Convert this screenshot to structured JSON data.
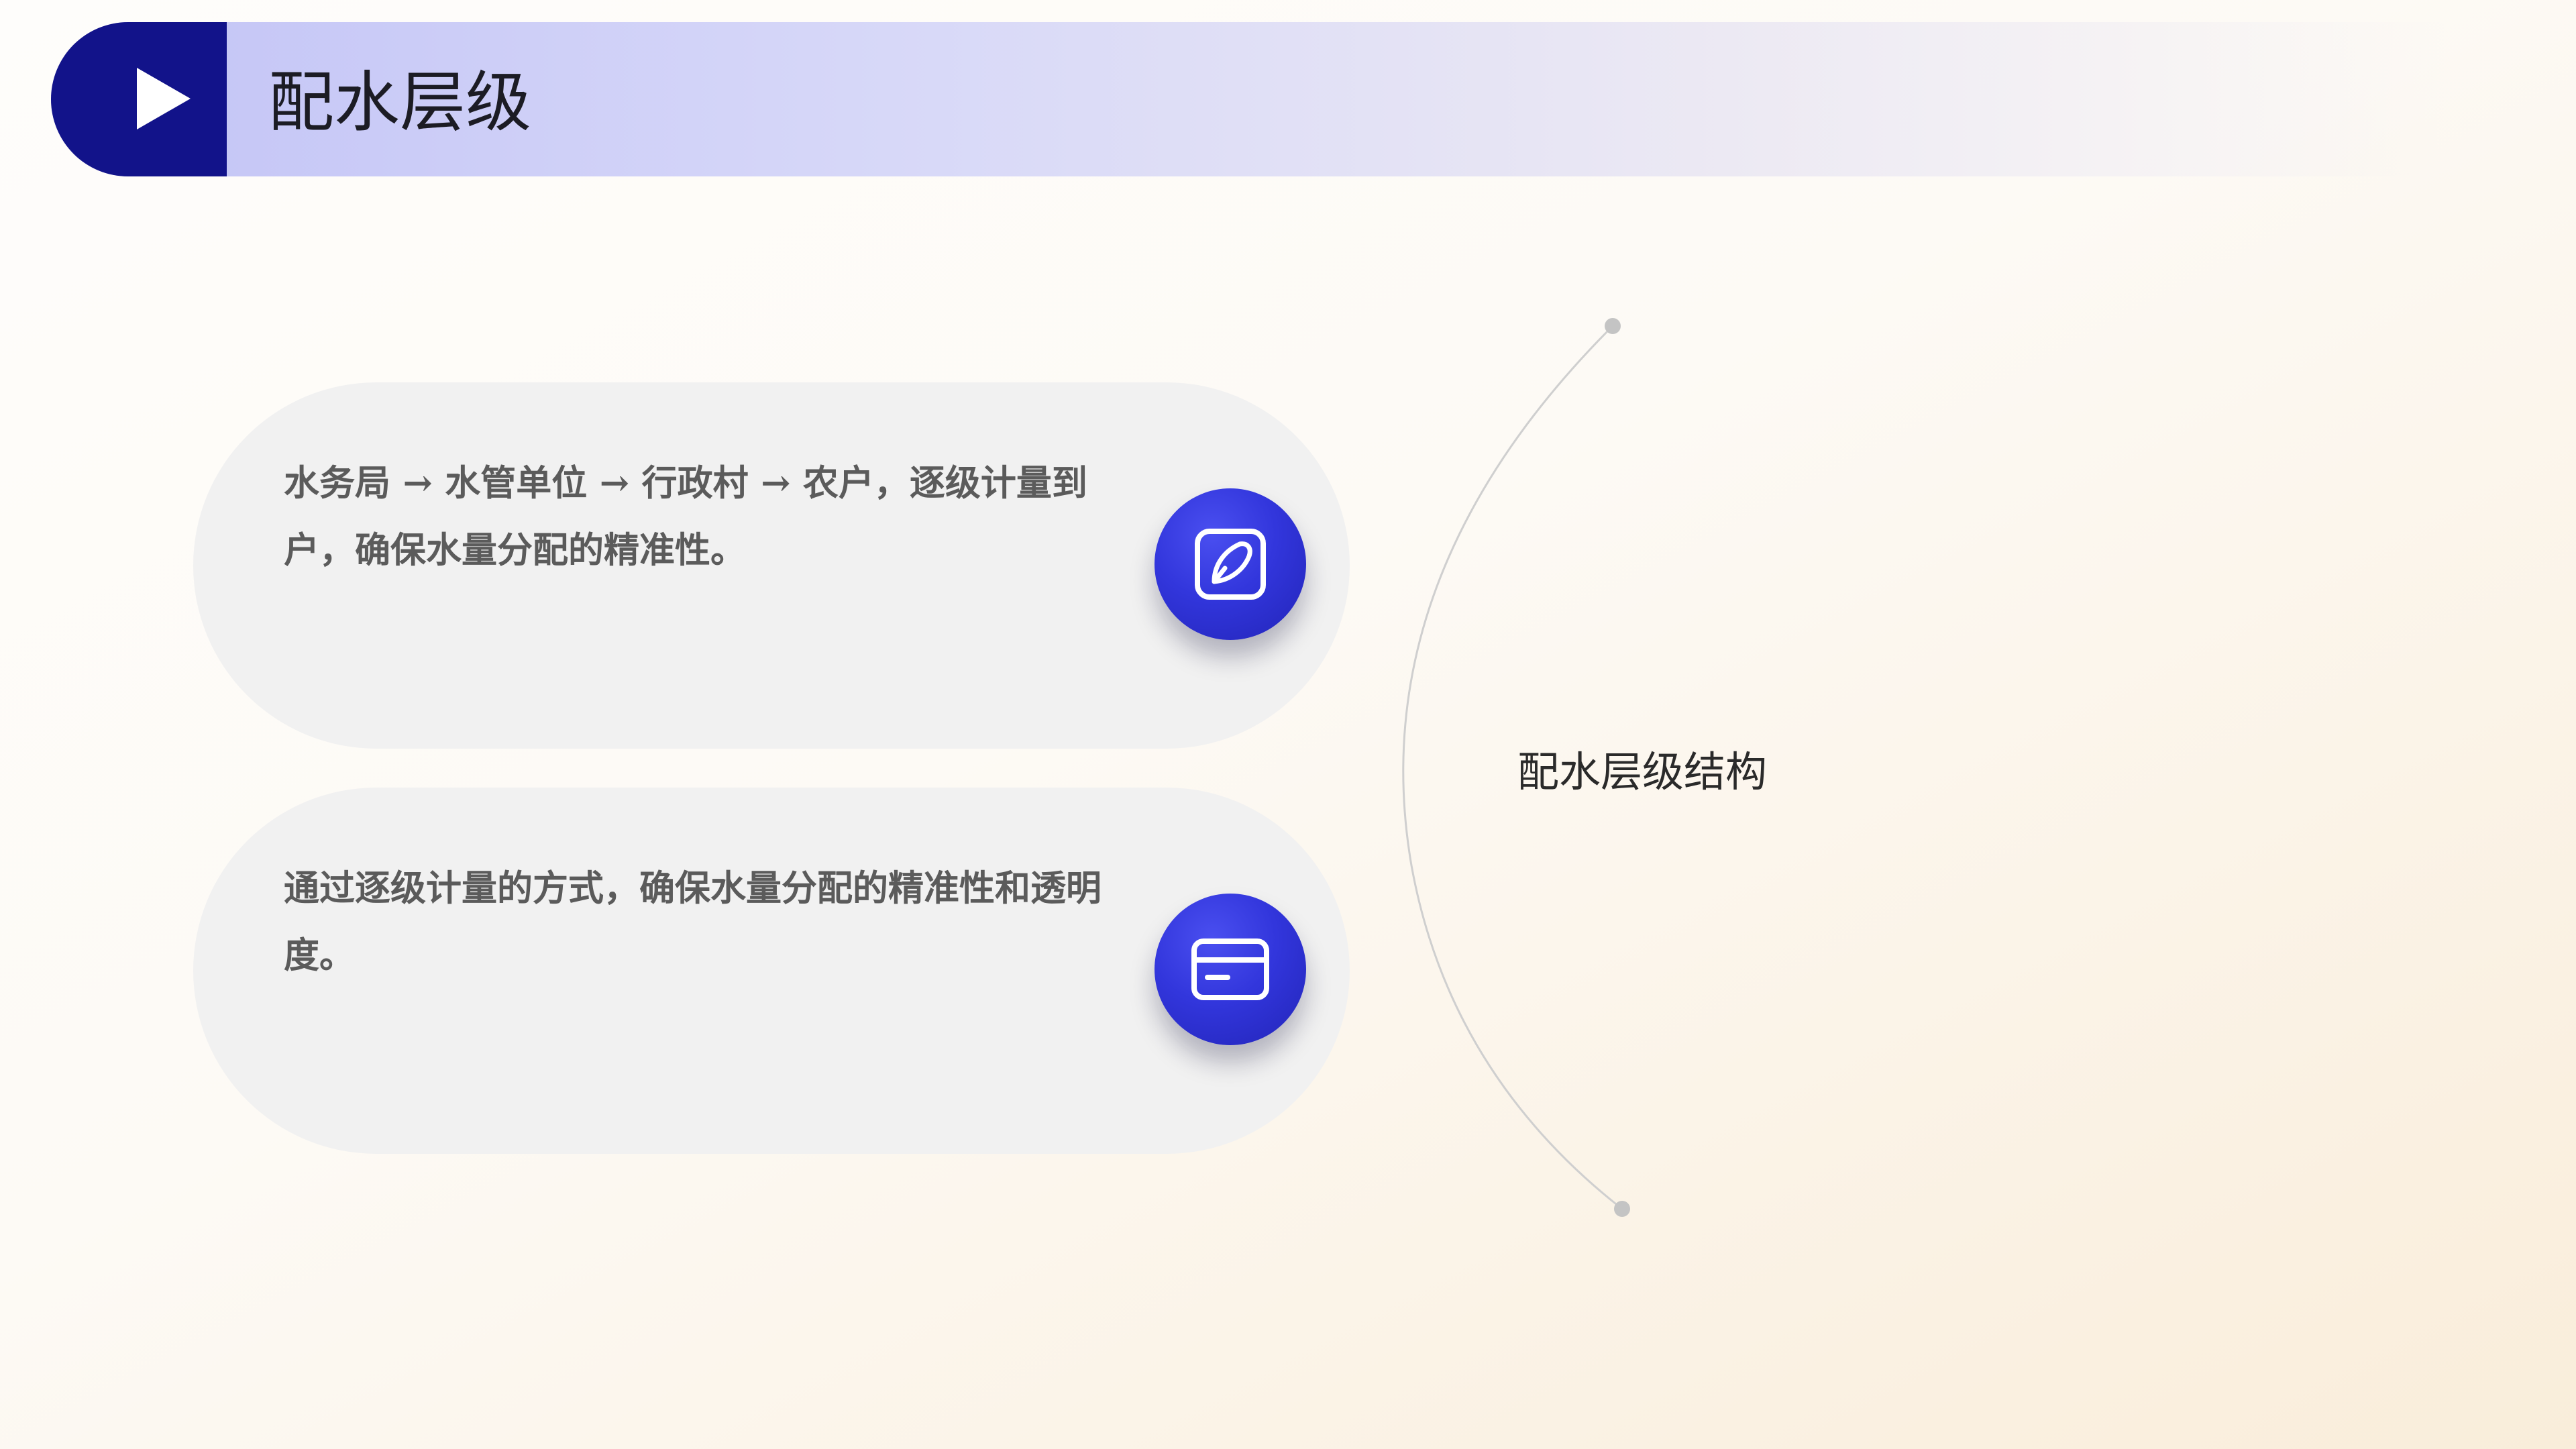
{
  "header": {
    "title": "配水层级",
    "icon": "play-icon"
  },
  "cards": [
    {
      "text": "水务局 → 水管单位 → 行政村 → 农户，逐级计量到户，确保水量分配的精准性。",
      "icon": "edit-icon"
    },
    {
      "text": "通过逐级计量的方式，确保水量分配的精准性和透明度。",
      "icon": "card-icon"
    }
  ],
  "side": {
    "label": "配水层级结构"
  },
  "colors": {
    "badge": "#12138a",
    "icon_circle": "#3236dc",
    "card_bg": "#f1f1f1",
    "card_text": "#5b5b5b",
    "arc": "#cfcfcf"
  }
}
